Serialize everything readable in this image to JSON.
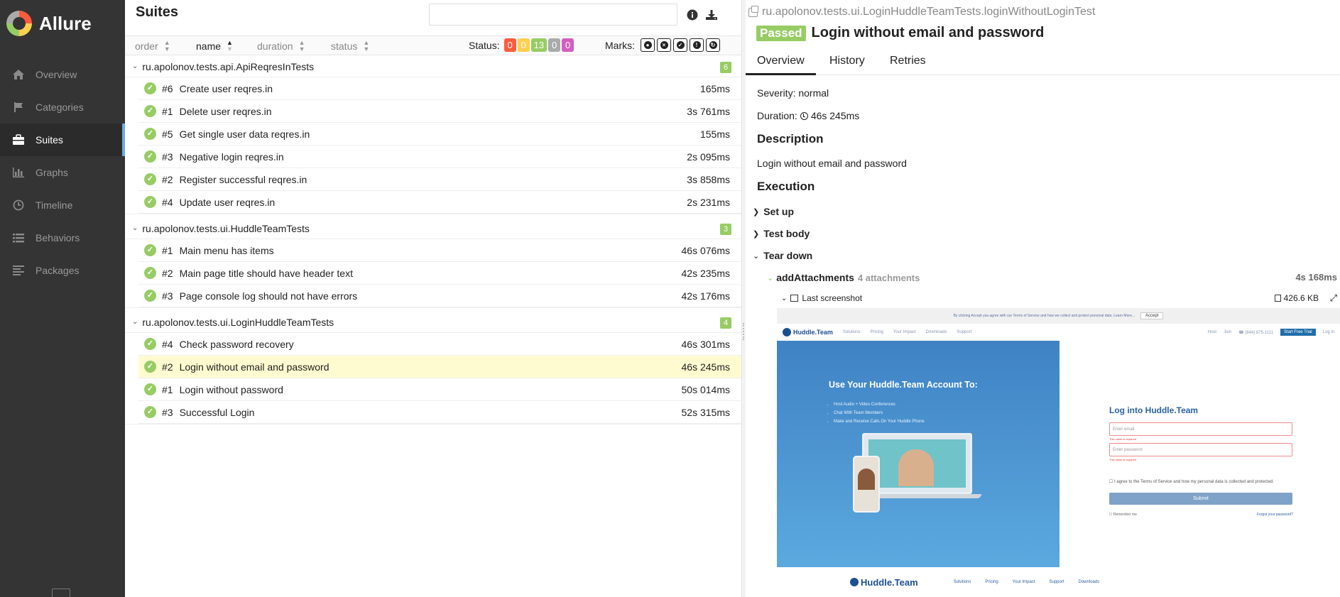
{
  "app": {
    "name": "Allure"
  },
  "sidebar": {
    "items": [
      {
        "label": "Overview",
        "icon": "home-icon"
      },
      {
        "label": "Categories",
        "icon": "flag-icon"
      },
      {
        "label": "Suites",
        "icon": "briefcase-icon",
        "active": true
      },
      {
        "label": "Graphs",
        "icon": "bar-chart-icon"
      },
      {
        "label": "Timeline",
        "icon": "clock-icon"
      },
      {
        "label": "Behaviors",
        "icon": "list-icon"
      },
      {
        "label": "Packages",
        "icon": "align-left-icon"
      }
    ]
  },
  "suites": {
    "title": "Suites",
    "search": {
      "value": "",
      "placeholder": ""
    },
    "sort": {
      "order": "order",
      "name": "name",
      "duration": "duration",
      "status": "status"
    },
    "status_label": "Status:",
    "status_counts": [
      {
        "value": "0",
        "color": "#fd5a3e"
      },
      {
        "value": "0",
        "color": "#ffd050"
      },
      {
        "value": "13",
        "color": "#97cc64"
      },
      {
        "value": "0",
        "color": "#aaaaaa"
      },
      {
        "value": "0",
        "color": "#d35ebe"
      }
    ],
    "marks_label": "Marks:",
    "groups": [
      {
        "name": "ru.apolonov.tests.api.ApiReqresInTests",
        "count": "6",
        "tests": [
          {
            "num": "#6",
            "name": "Create user reqres.in",
            "duration": "165ms"
          },
          {
            "num": "#1",
            "name": "Delete user reqres.in",
            "duration": "3s 761ms"
          },
          {
            "num": "#5",
            "name": "Get single user data reqres.in",
            "duration": "155ms"
          },
          {
            "num": "#3",
            "name": "Negative login reqres.in",
            "duration": "2s 095ms"
          },
          {
            "num": "#2",
            "name": "Register successful reqres.in",
            "duration": "3s 858ms"
          },
          {
            "num": "#4",
            "name": "Update user reqres.in",
            "duration": "2s 231ms"
          }
        ]
      },
      {
        "name": "ru.apolonov.tests.ui.HuddleTeamTests",
        "count": "3",
        "tests": [
          {
            "num": "#1",
            "name": "Main menu has items",
            "duration": "46s 076ms"
          },
          {
            "num": "#2",
            "name": "Main page title should have header text",
            "duration": "42s 235ms"
          },
          {
            "num": "#3",
            "name": "Page console log should not have errors",
            "duration": "42s 176ms"
          }
        ]
      },
      {
        "name": "ru.apolonov.tests.ui.LoginHuddleTeamTests",
        "count": "4",
        "tests": [
          {
            "num": "#4",
            "name": "Check password recovery",
            "duration": "46s 301ms"
          },
          {
            "num": "#2",
            "name": "Login without email and password",
            "duration": "46s 245ms",
            "selected": true
          },
          {
            "num": "#1",
            "name": "Login without password",
            "duration": "50s 014ms"
          },
          {
            "num": "#3",
            "name": "Successful Login",
            "duration": "52s 315ms"
          }
        ]
      }
    ]
  },
  "detail": {
    "breadcrumb": "ru.apolonov.tests.ui.LoginHuddleTeamTests.loginWithoutLoginTest",
    "status": "Passed",
    "title": "Login without email and password",
    "tabs": [
      "Overview",
      "History",
      "Retries"
    ],
    "severity": "Severity: normal",
    "duration_label": "Duration:",
    "duration": "46s 245ms",
    "description_heading": "Description",
    "description": "Login without email and password",
    "execution_heading": "Execution",
    "steps": [
      "Set up",
      "Test body",
      "Tear down"
    ],
    "attachment_step": {
      "name": "addAttachments",
      "meta": "4 attachments",
      "time": "4s 168ms"
    },
    "attachment": {
      "name": "Last screenshot",
      "size": "426.6 KB"
    }
  },
  "screenshot": {
    "cookie_text": "By clicking Accept you agree with our Terms of Service and how we collect and protect personal data. Learn More...",
    "accept": "Accept",
    "brand": "Huddle.Team",
    "nav": [
      "Solutions",
      "Pricing",
      "Your Impact",
      "Downloads",
      "Support"
    ],
    "nav_right": [
      "Host",
      "Join",
      "☎ (844) 875-1111",
      "Start Free Trial",
      "Log in"
    ],
    "hero_title": "Use Your Huddle.Team Account To:",
    "hero_points": [
      "Host Audio + Video Conferences",
      "Chat With Team Members",
      "Make and Receive Calls On Your Huddle Phone"
    ],
    "form_title": "Log into Huddle.Team",
    "email_placeholder": "Enter email",
    "password_placeholder": "Enter password",
    "required": "This value is required",
    "agree": "I agree to the Terms of Service and how my personal data is collected and protected.",
    "submit": "Submit",
    "remember": "Remember me",
    "forgot": "Forgot your password?",
    "footer_nav": [
      "Solutions",
      "Pricing",
      "Your Impact",
      "Support",
      "Downloads"
    ]
  }
}
